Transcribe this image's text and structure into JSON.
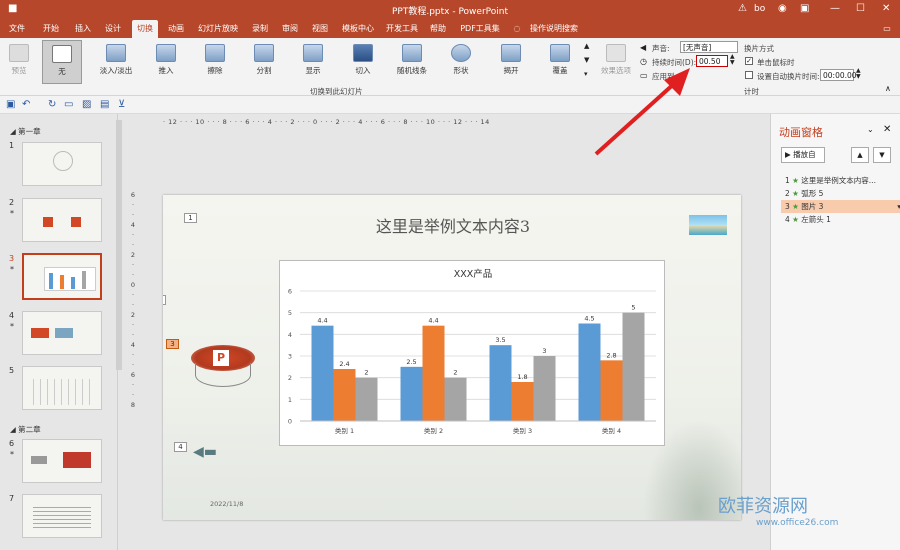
{
  "window": {
    "title": "PPT教程.pptx  -  PowerPoint",
    "user": "bo"
  },
  "tabs": [
    "文件",
    "开始",
    "插入",
    "设计",
    "切换",
    "动画",
    "幻灯片放映",
    "录制",
    "审阅",
    "视图",
    "模板中心",
    "开发工具",
    "帮助",
    "PDF工具集",
    "操作说明搜索"
  ],
  "active_tab": "切换",
  "ribbon": {
    "preview_label": "预览",
    "transitions": [
      "无",
      "淡入/淡出",
      "推入",
      "擦除",
      "分割",
      "显示",
      "切入",
      "随机线条",
      "形状",
      "揭开",
      "覆盖"
    ],
    "effect_options": "效果选项",
    "group_label": "切换到此幻灯片",
    "sound_label": "声音:",
    "sound_value": "[无声音]",
    "duration_label": "持续时间(D):",
    "duration_value": "00.50",
    "apply_all_label": "应用到",
    "advance_title": "换片方式",
    "on_click_label": "单击鼠标时",
    "after_label": "设置自动换片时间:",
    "after_value": "00:00.00",
    "timing_label": "计时"
  },
  "thumbnails": {
    "section1": "第一章",
    "section2": "第二章",
    "slides": [
      {
        "num": "1",
        "star": ""
      },
      {
        "num": "2",
        "star": "*"
      },
      {
        "num": "3",
        "star": "*"
      },
      {
        "num": "4",
        "star": "*"
      },
      {
        "num": "5",
        "star": ""
      },
      {
        "num": "6",
        "star": "*"
      },
      {
        "num": "7",
        "star": ""
      }
    ]
  },
  "slide": {
    "title": "这里是举例文本内容3",
    "date": "2022/11/8",
    "anim_tags": [
      "1",
      "2",
      "3",
      "4"
    ]
  },
  "chart_data": {
    "type": "bar",
    "title": "XXX产品",
    "categories": [
      "类别 1",
      "类别 2",
      "类别 3",
      "类别 4"
    ],
    "series": [
      {
        "values": [
          4.4,
          2.5,
          3.5,
          4.5
        ],
        "color": "#5b9bd5"
      },
      {
        "values": [
          2.4,
          4.4,
          1.8,
          2.8
        ],
        "color": "#ed7d31"
      },
      {
        "values": [
          2,
          2,
          3,
          5
        ],
        "color": "#a5a5a5"
      }
    ],
    "ylim": [
      0,
      6
    ],
    "yticks": [
      "0",
      "1",
      "2",
      "3",
      "4",
      "5",
      "6"
    ],
    "grid": true
  },
  "pane": {
    "title": "动画窗格",
    "play_label": "播放自",
    "items": [
      {
        "num": "1",
        "label": "这里是举例文本内容..."
      },
      {
        "num": "2",
        "label": "弧形 5"
      },
      {
        "num": "3",
        "label": "图片 3"
      },
      {
        "num": "4",
        "label": "左箭头 1"
      }
    ]
  },
  "watermark": {
    "cn": "欧菲资源网",
    "url": "www.office26.com"
  }
}
